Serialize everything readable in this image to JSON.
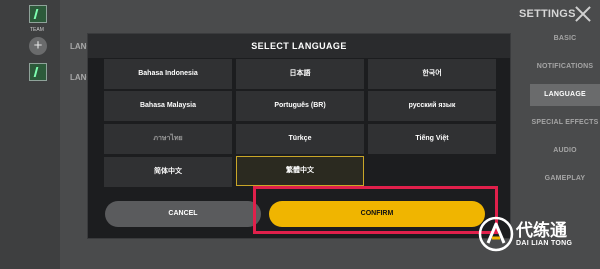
{
  "background": {
    "team_label": "TEAM",
    "add_symbol": "+",
    "lang_label_1": "LANG",
    "lang_label_2": "LANG",
    "settings_title": "SETTINGS",
    "sidebar": [
      {
        "label": "BASIC",
        "active": false
      },
      {
        "label": "NOTIFICATIONS",
        "active": false
      },
      {
        "label": "LANGUAGE",
        "active": true
      },
      {
        "label": "SPECIAL EFFECTS",
        "active": false
      },
      {
        "label": "AUDIO",
        "active": false
      },
      {
        "label": "GAMEPLAY",
        "active": false
      }
    ]
  },
  "dialog": {
    "title": "SELECT LANGUAGE",
    "languages": [
      {
        "label": "Bahasa Indonesia"
      },
      {
        "label": "日本語"
      },
      {
        "label": "한국어"
      },
      {
        "label": "Bahasa Malaysia"
      },
      {
        "label": "Português (BR)"
      },
      {
        "label": "русский язык"
      },
      {
        "label": "ภาษาไทย"
      },
      {
        "label": "Türkçe"
      },
      {
        "label": "Tiếng Việt"
      },
      {
        "label": "简体中文"
      },
      {
        "label": "繁體中文",
        "selected": true
      }
    ],
    "cancel_label": "CANCEL",
    "confirm_label": "CONFIRM"
  },
  "watermark": {
    "text": "代练通",
    "subtext": "DAI LIAN TONG"
  },
  "colors": {
    "accent": "#f0b500",
    "highlight": "#e0204b",
    "selected_border": "#c9a628"
  }
}
